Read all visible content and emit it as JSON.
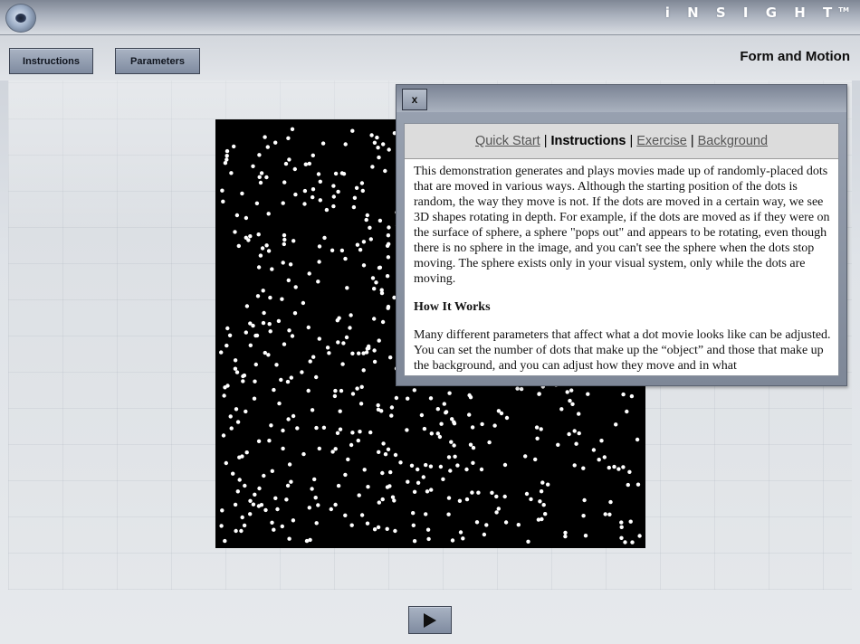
{
  "app": {
    "brand": "INSIGHT",
    "brand_mark": "TM",
    "page_title": "Form and Motion"
  },
  "toolbar": {
    "instructions_label": "Instructions",
    "parameters_label": "Parameters"
  },
  "dialog": {
    "close_label": "x",
    "nav": {
      "quick_start": "Quick Start",
      "instructions": "Instructions",
      "exercise": "Exercise",
      "background": "Background",
      "separator": "|"
    },
    "intro_paragraph": "This demonstration generates and plays movies made up of randomly-placed dots that are moved in various ways. Although the starting position of the dots is random, the way they move is not. If the dots are moved in a certain way, we see 3D shapes rotating in depth. For example, if the dots are moved as if they were on the surface of sphere, a sphere \"pops out\" and appears to be rotating, even though there is no sphere in the image, and you can't see the sphere when the dots stop moving. The sphere exists only in your visual system, only while the dots are moving.",
    "section_heading": "How It Works",
    "section_paragraph": "Many different parameters that affect what a dot movie looks like can be adjusted. You can set the number of dots that make up the “object” and those that make up the background, and you can adjust how they move and in what"
  },
  "icons": {
    "logo": "eye-icon",
    "play": "play-icon"
  },
  "colors": {
    "canvas_background": "#000000",
    "dot_color": "#ffffff",
    "button_face": "#8e99ad",
    "link_color": "#555555"
  }
}
